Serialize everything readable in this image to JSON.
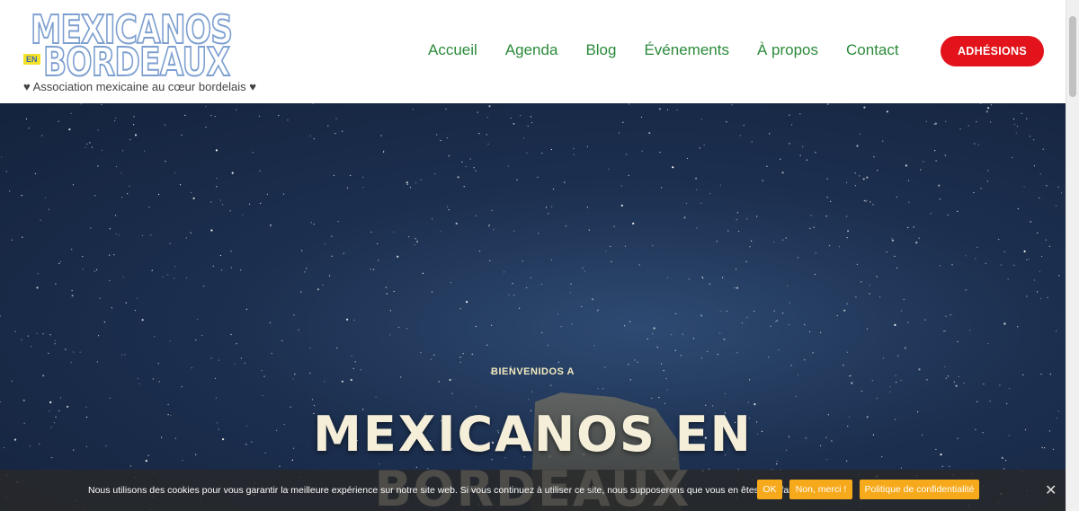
{
  "header": {
    "logo_line1": "MEXICANOS",
    "logo_en": "EN",
    "logo_line2": "BORDEAUX",
    "tagline": "♥ Association mexicaine au cœur bordelais ♥",
    "nav": [
      "Accueil",
      "Agenda",
      "Blog",
      "Événements",
      "À propos",
      "Contact"
    ],
    "join_label": "ADHÉSIONS"
  },
  "hero": {
    "kicker": "BIENVENIDOS A",
    "title_line1": "MEXICANOS EN",
    "title_line2": "BORDEAUX"
  },
  "cookie": {
    "text": "Nous utilisons des cookies pour vous garantir la meilleure expérience sur notre site web. Si vous continuez à utiliser ce site, nous supposerons que vous en êtes satisfait.",
    "ok": "OK",
    "no": "Non, merci !",
    "policy": "Politique de confidentialité",
    "close": "✕"
  },
  "colors": {
    "nav": "#2a8a3a",
    "join_button": "#e2131b",
    "cookie_button": "#f7a91c",
    "logo": "#7d9fd0",
    "hero_sky": "#1c2f4f"
  }
}
